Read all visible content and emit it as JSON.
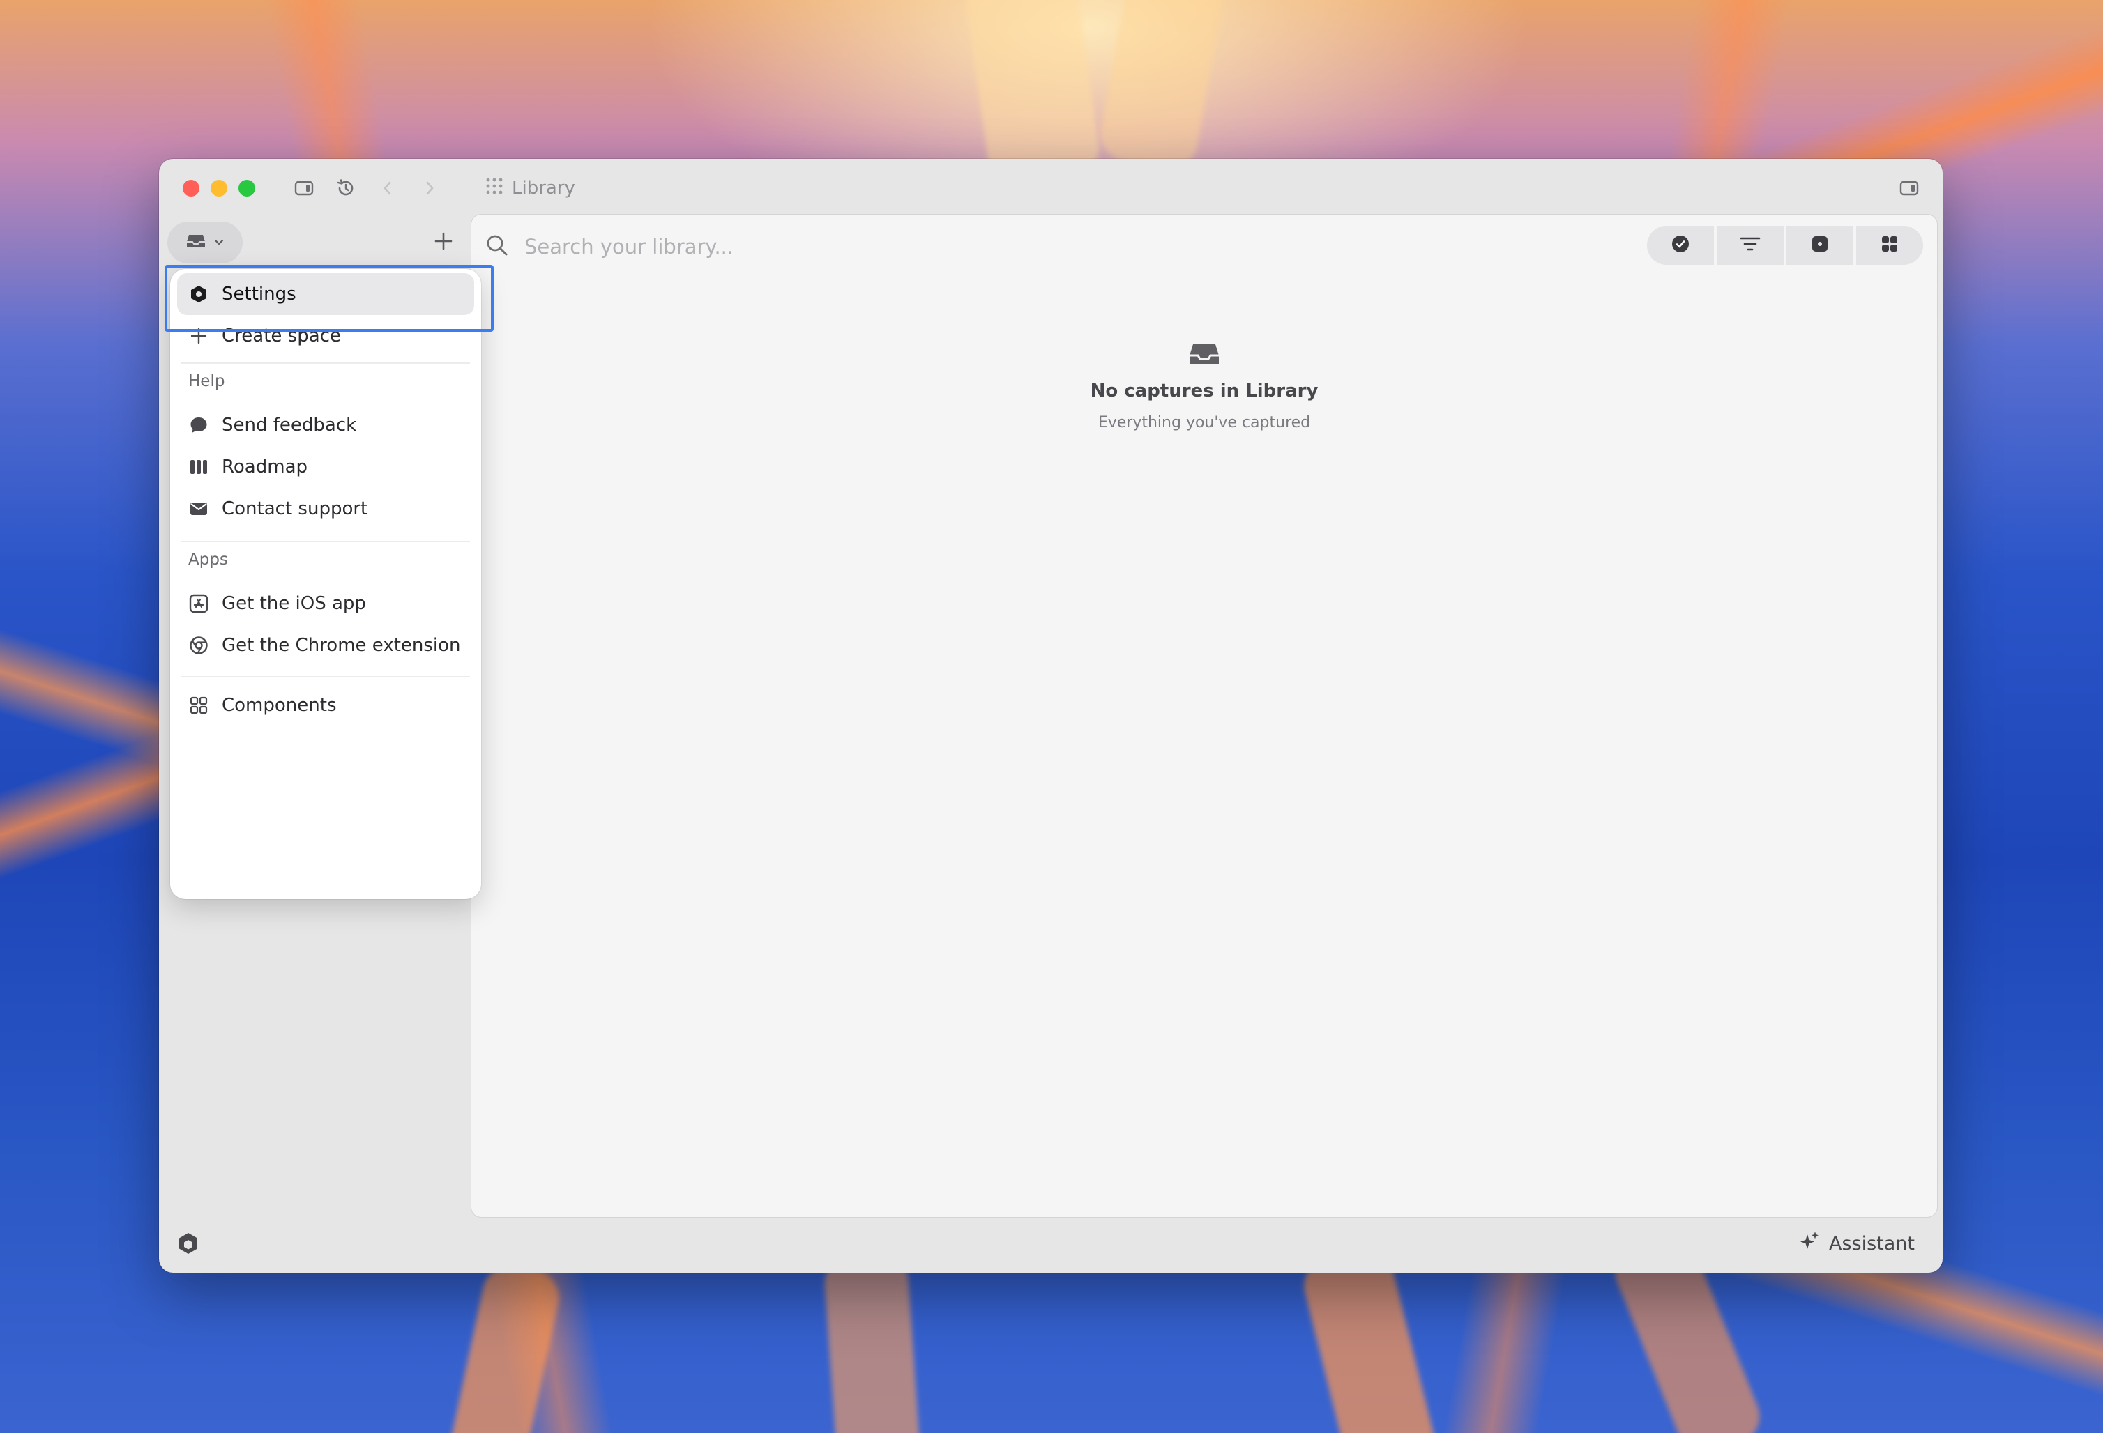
{
  "window": {
    "breadcrumb": "Library"
  },
  "search": {
    "placeholder": "Search your library...",
    "value": ""
  },
  "menu": {
    "settings": "Settings",
    "create_space": "Create space",
    "help_section": "Help",
    "send_feedback": "Send feedback",
    "roadmap": "Roadmap",
    "contact_support": "Contact support",
    "apps_section": "Apps",
    "ios_app": "Get the iOS app",
    "chrome_extension": "Get the Chrome extension",
    "components": "Components"
  },
  "empty_state": {
    "title": "No captures in Library",
    "subtitle": "Everything you've captured"
  },
  "footer": {
    "assistant_label": "Assistant"
  },
  "icons": {
    "settings": "hexagon-icon",
    "create_space": "plus-icon",
    "send_feedback": "chat-bubble-icon",
    "roadmap": "roadmap-icon",
    "contact_support": "envelope-icon",
    "ios_app": "app-store-icon",
    "chrome_extension": "chrome-icon",
    "components": "grid-icon"
  },
  "colors": {
    "highlight": "#3a7df0",
    "traffic_close": "#ff5f57",
    "traffic_minimize": "#febc2e",
    "traffic_zoom": "#28c840"
  }
}
